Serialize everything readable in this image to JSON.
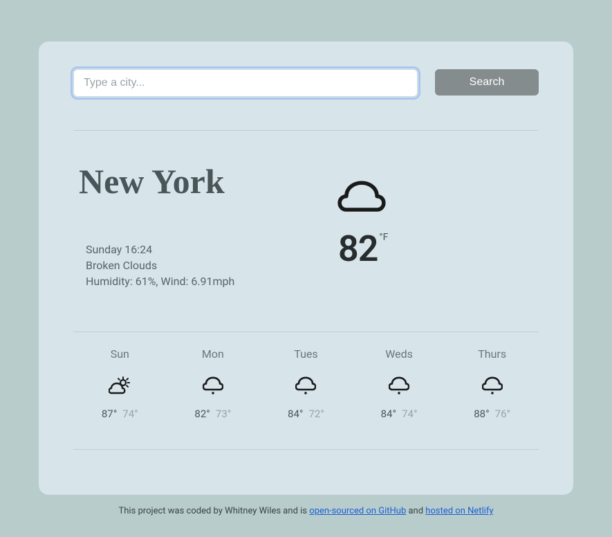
{
  "search": {
    "placeholder": "Type a city...",
    "button": "Search"
  },
  "current": {
    "city": "New York",
    "datetime": "Sunday 16:24",
    "condition": "Broken Clouds",
    "stats": "Humidity: 61%, Wind: 6.91mph",
    "temp": "82",
    "unit": "°F",
    "icon": "cloud"
  },
  "forecast": [
    {
      "day": "Sun",
      "icon": "partly",
      "hi": "87°",
      "lo": "74°"
    },
    {
      "day": "Mon",
      "icon": "cloud-rain",
      "hi": "82°",
      "lo": "73°"
    },
    {
      "day": "Tues",
      "icon": "cloud-rain",
      "hi": "84°",
      "lo": "72°"
    },
    {
      "day": "Weds",
      "icon": "cloud-rain",
      "hi": "84°",
      "lo": "74°"
    },
    {
      "day": "Thurs",
      "icon": "cloud-rain",
      "hi": "88°",
      "lo": "76°"
    }
  ],
  "footer": {
    "prefix": "This project was coded by Whitney Wiles and is ",
    "link1": "open-sourced on GitHub",
    "mid": " and ",
    "link2": "hosted on Netlify"
  }
}
